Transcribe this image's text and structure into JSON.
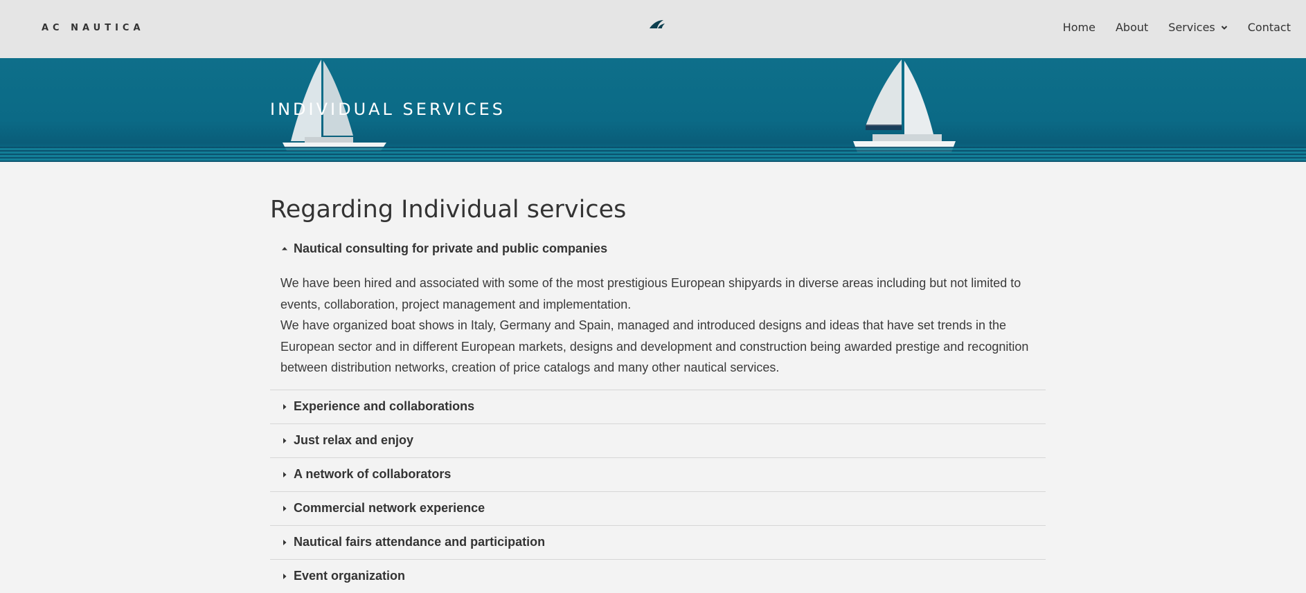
{
  "header": {
    "brand": "AC NAUTICA",
    "logo_icon": "sailboat-logo-icon",
    "nav": [
      {
        "label": "Home"
      },
      {
        "label": "About"
      },
      {
        "label": "Services",
        "icon": "chevron-down-icon"
      },
      {
        "label": "Contact"
      }
    ]
  },
  "hero": {
    "title": "INDIVIDUAL SERVICES"
  },
  "main": {
    "heading": "Regarding Individual services",
    "accordion": [
      {
        "title": "Nautical consulting for private and public companies",
        "expanded": true,
        "paragraphs": [
          "We have been hired and associated with some of the most prestigious European shipyards in diverse areas including but not limited to events, collaboration, project management and implementation.",
          "We have organized boat shows in Italy, Germany and Spain, managed and introduced designs and ideas that have set trends in the European sector and in different European markets, designs and development and construction being awarded prestige and recognition between distribution networks, creation of price catalogs and many other nautical services."
        ]
      },
      {
        "title": "Experience and collaborations",
        "expanded": false
      },
      {
        "title": "Just relax and enjoy",
        "expanded": false
      },
      {
        "title": "A network of collaborators",
        "expanded": false
      },
      {
        "title": "Commercial network experience",
        "expanded": false
      },
      {
        "title": "Nautical fairs attendance and participation",
        "expanded": false
      },
      {
        "title": "Event organization",
        "expanded": false
      }
    ]
  },
  "colors": {
    "header_bg": "#e5e5e5",
    "hero_bg": "#0b6a86",
    "page_bg": "#f3f3f3",
    "logo": "#0d3f4f"
  }
}
